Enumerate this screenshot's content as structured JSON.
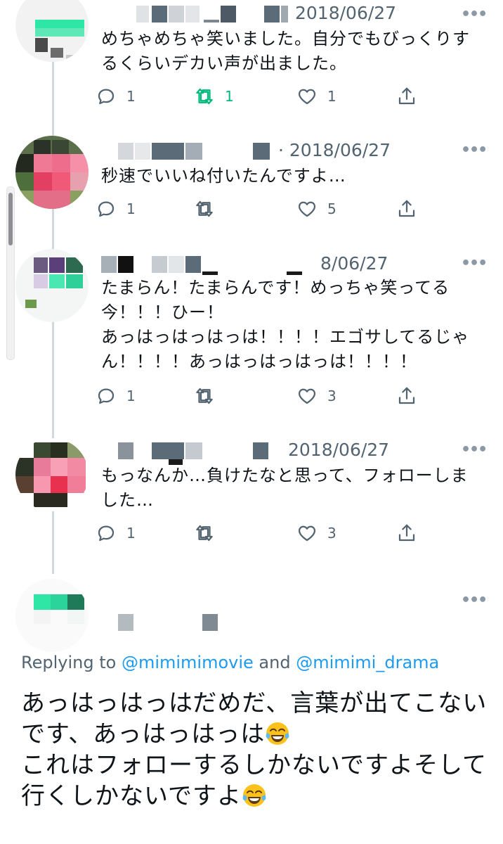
{
  "tweets": [
    {
      "date": "2018/06/27",
      "text": "めちゃめちゃ笑いました。自分でもびっくりするくらいデカい声が出ました。",
      "reply_count": "1",
      "retweet_count": "1",
      "like_count": "1"
    },
    {
      "date": "2018/06/27",
      "text": "秒速でいいね付いたんですよ…",
      "reply_count": "1",
      "retweet_count": "",
      "like_count": "5"
    },
    {
      "date": "8/06/27",
      "text": "たまらん！たまらんです！めっちゃ笑ってる今！！！ひー！\nあっはっはっはっは！！！！エゴサしてるじゃん！！！！あっはっはっはっは！！！！",
      "reply_count": "1",
      "retweet_count": "",
      "like_count": "3"
    },
    {
      "date": "2018/06/27",
      "text": "もっなんか…負けたなと思って、フォローしました…",
      "reply_count": "1",
      "retweet_count": "",
      "like_count": "3"
    }
  ],
  "focused": {
    "replying_prefix": "Replying to ",
    "mention1": "@mimimimovie",
    "and_word": " and ",
    "mention2": "@mimimi_drama",
    "line1": "あっはっはっはだめだ、言葉が出てこないです、あっはっはっは",
    "line2": "これはフォローするしかないですよそして行くしかないですよ"
  },
  "icons": {
    "reply": "reply-icon",
    "retweet": "retweet-icon",
    "like": "heart-icon",
    "share": "share-icon",
    "more": "more-icon",
    "emoji": "tears-of-joy-emoji"
  },
  "colors": {
    "text": "#0f1419",
    "secondary": "#536471",
    "link": "#1d9bf0",
    "retweet_active": "#00ba7c",
    "thread_line": "#cfd9de"
  }
}
